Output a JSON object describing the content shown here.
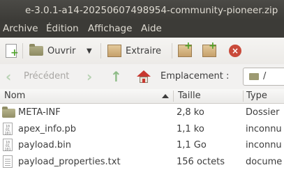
{
  "window": {
    "title": "e-3.0.1-a14-20250607498954-community-pioneer.zip"
  },
  "menu": {
    "items": [
      "Archive",
      "Édition",
      "Affichage",
      "Aide"
    ]
  },
  "toolbar": {
    "open_label": "Ouvrir",
    "extract_label": "Extraire"
  },
  "location": {
    "back_label": "Précédent",
    "label": "Emplacement :",
    "path": "/"
  },
  "columns": {
    "name": "Nom",
    "size": "Taille",
    "type": "Type"
  },
  "files": [
    {
      "name": "META-INF",
      "size": "2,8 ko",
      "type": "Dossier",
      "icon": "folder-icon"
    },
    {
      "name": "apex_info.pb",
      "size": "1,1 ko",
      "type": "inconnu",
      "icon": "binary-file-icon"
    },
    {
      "name": "payload.bin",
      "size": "1,1 Go",
      "type": "inconnu",
      "icon": "binary-file-icon"
    },
    {
      "name": "payload_properties.txt",
      "size": "156 octets",
      "type": "docume",
      "icon": "text-file-icon"
    }
  ]
}
